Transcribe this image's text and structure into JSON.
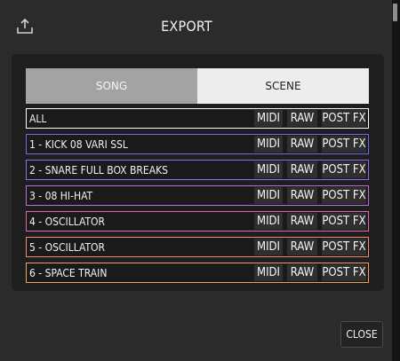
{
  "dialog": {
    "title": "EXPORT",
    "share_icon": "share-export-icon",
    "close_label": "CLOSE"
  },
  "tabs": [
    {
      "label": "SONG",
      "selected": true
    },
    {
      "label": "SCENE",
      "selected": false
    }
  ],
  "options": {
    "midi": "MIDI",
    "raw": "RAW",
    "postfx": "POST FX"
  },
  "tracks": [
    {
      "name": "ALL",
      "color": "#ffffff"
    },
    {
      "name": "1 - KICK 08 VARI SSL",
      "color": "#6b6bf0"
    },
    {
      "name": "2 - SNARE FULL BOX BREAKS",
      "color": "#9a6bf0"
    },
    {
      "name": "3 - 08 HI-HAT",
      "color": "#c06be0"
    },
    {
      "name": "4 - OSCILLATOR",
      "color": "#e06bb0"
    },
    {
      "name": "5 - OSCILLATOR",
      "color": "#f08a70"
    },
    {
      "name": "6 - SPACE TRAIN",
      "color": "#f0a060"
    }
  ],
  "colors": {
    "background": "#2b2b2b",
    "panel": "#1e1e1e",
    "tab_selected": "#a3a3a3",
    "tab_unselected": "#ededed"
  }
}
